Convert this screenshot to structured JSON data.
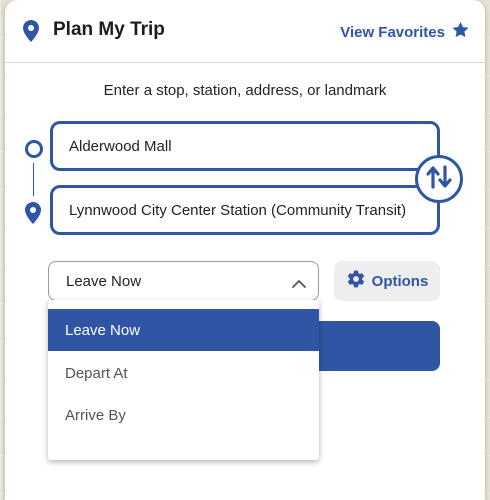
{
  "header": {
    "title": "Plan My Trip",
    "favorites_label": "View Favorites",
    "title_icon": "map-pin-icon",
    "favorites_icon": "star-icon"
  },
  "instructions": "Enter a stop, station, address, or landmark",
  "trip": {
    "from_value": "Alderwood Mall",
    "to_value": "Lynnwood City Center Station (Community Transit)",
    "swap_icon": "swap-arrows-icon"
  },
  "time_select": {
    "selected": "Leave Now",
    "options": [
      "Leave Now",
      "Depart At",
      "Arrive By"
    ]
  },
  "options_button": {
    "label": "Options",
    "icon": "gear-icon"
  },
  "colors": {
    "accent": "#2f55a4",
    "panel": "#ffffff",
    "options_bg": "#eeeeee"
  }
}
